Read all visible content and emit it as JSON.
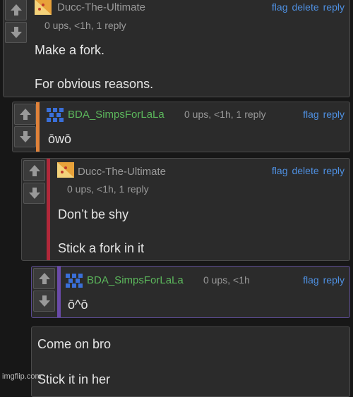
{
  "comments": [
    {
      "username": "Ducc-The-Ultimate",
      "meta": "0 ups, <1h, 1 reply",
      "actions": [
        "flag",
        "delete",
        "reply"
      ],
      "lines": [
        "Make a fork.",
        "For obvious reasons."
      ]
    },
    {
      "username": "BDA_SimpsForLaLa",
      "meta": "0 ups, <1h, 1 reply",
      "actions": [
        "flag",
        "reply"
      ],
      "lines": [
        "ōwō"
      ]
    },
    {
      "username": "Ducc-The-Ultimate",
      "meta": "0 ups, <1h, 1 reply",
      "actions": [
        "flag",
        "delete",
        "reply"
      ],
      "lines": [
        "Don’t be shy",
        "Stick a fork in it"
      ]
    },
    {
      "username": "BDA_SimpsForLaLa",
      "meta": "0 ups, <1h",
      "actions": [
        "flag",
        "reply"
      ],
      "lines": [
        "ō^ō"
      ]
    },
    {
      "lines": [
        "Come on bro",
        "Stick it in her"
      ]
    }
  ],
  "colors": {
    "username_ducc": "#9a9a9a",
    "username_bda": "#5cb85c",
    "stripe_orange": "#e0823a",
    "stripe_crimson": "#b0283a",
    "stripe_purple": "#6a4aa8",
    "link_blue": "#4e8fe0"
  },
  "icons": [
    "up-arrow-icon",
    "down-arrow-icon",
    "pizza-avatar-icon",
    "pixel-avatar-icon"
  ],
  "watermark": "imgflip.com"
}
